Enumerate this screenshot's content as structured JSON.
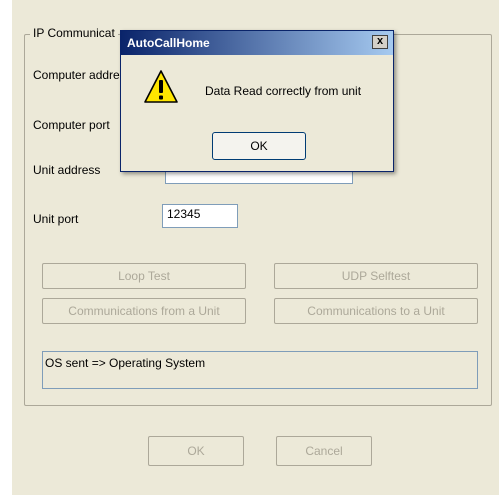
{
  "group": {
    "title": "IP Communicat"
  },
  "labels": {
    "computer_address": "Computer addre",
    "computer_port": "Computer port",
    "unit_address": "Unit address",
    "unit_port": "Unit port"
  },
  "fields": {
    "unit_port": "12345"
  },
  "buttons": {
    "loop_test": "Loop Test",
    "udp_selftest": "UDP Selftest",
    "comm_from_unit": "Communications from a Unit",
    "comm_to_unit": "Communications to a Unit",
    "ok": "OK",
    "cancel": "Cancel"
  },
  "info_box": {
    "text": "OS sent => Operating System"
  },
  "dialog": {
    "title": "AutoCallHome",
    "close": "x",
    "message": "Data Read correctly from unit",
    "ok": "OK",
    "icon": "warning-icon"
  }
}
